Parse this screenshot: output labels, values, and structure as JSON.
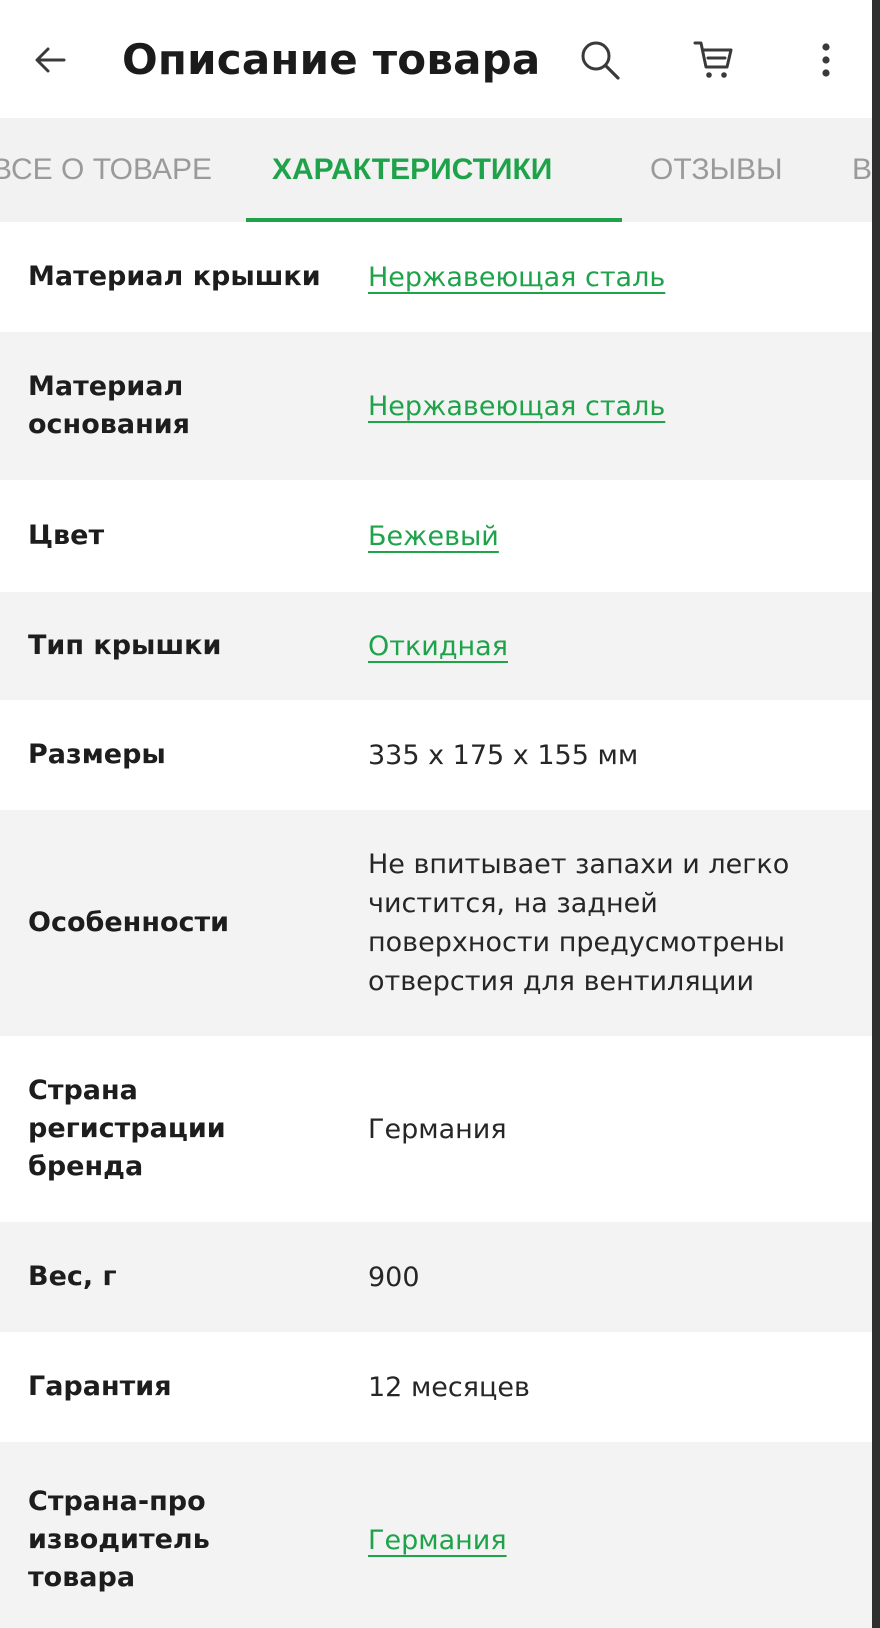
{
  "header": {
    "title": "Описание товара",
    "back_icon": "arrow-left-icon",
    "search_icon": "search-icon",
    "cart_icon": "cart-icon",
    "menu_icon": "more-vertical-icon"
  },
  "tabs": [
    {
      "label": "ВСЕ О ТОВАРЕ",
      "active": false
    },
    {
      "label": "ХАРАКТЕРИСТИКИ",
      "active": true
    },
    {
      "label": "ОТЗЫВЫ",
      "active": false
    },
    {
      "label": "В",
      "active": false
    }
  ],
  "specs": [
    {
      "label": "Материал крышки",
      "value": "Нержавеющая сталь",
      "link": true
    },
    {
      "label": "Материал основания",
      "value": "Нержавеющая сталь",
      "link": true
    },
    {
      "label": "Цвет",
      "value": "Бежевый",
      "link": true
    },
    {
      "label": "Тип крышки",
      "value": "Откидная",
      "link": true
    },
    {
      "label": "Размеры",
      "value": "335 x 175 x 155 мм",
      "link": false
    },
    {
      "label": "Особенности",
      "value": "Не впитывает запахи и легко чистится, на задней поверхности предусмотрены отверстия для вентиляции",
      "link": false
    },
    {
      "label": "Страна регистрации бренда",
      "value": "Германия",
      "link": false
    },
    {
      "label": "Вес, г",
      "value": "900",
      "link": false
    },
    {
      "label": "Гарантия",
      "value": "12 месяцев",
      "link": false
    },
    {
      "label": "Страна-про изводитель товара",
      "value": "Германия",
      "link": true
    }
  ],
  "colors": {
    "accent": "#1fa34a",
    "tab_inactive": "#9a9a9a",
    "row_alt": "#f3f3f3"
  }
}
